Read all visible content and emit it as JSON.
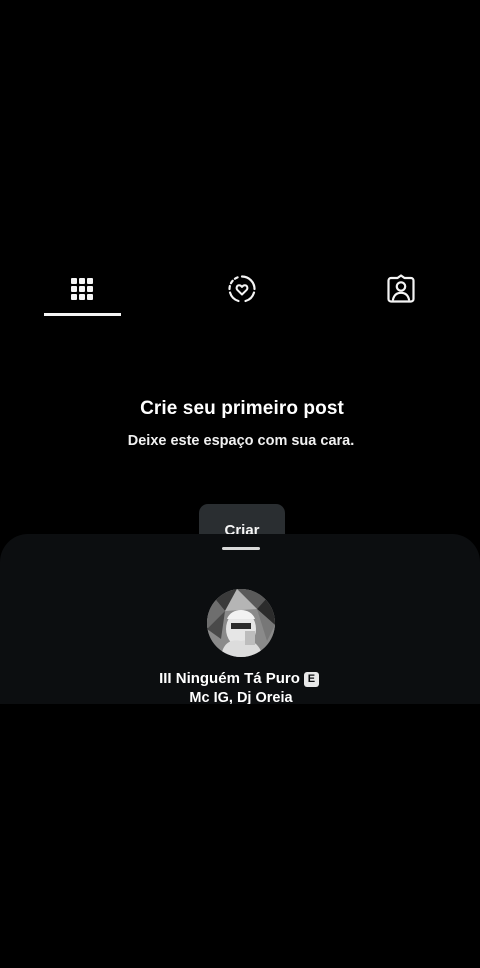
{
  "tabs": [
    {
      "name": "posts-grid",
      "icon": "grid-icon",
      "selected": true
    },
    {
      "name": "reels",
      "icon": "heart-circle-icon",
      "selected": false
    },
    {
      "name": "tagged",
      "icon": "tagged-person-icon",
      "selected": false
    }
  ],
  "empty_state": {
    "title": "Crie seu primeiro post",
    "subtitle": "Deixe este espaço com sua cara.",
    "create_label": "Criar"
  },
  "music_sheet": {
    "track_title": "III Ninguém Tá Puro",
    "explicit_badge": "E",
    "artist": "Mc IG, Dj Oreia",
    "cover_icon": "album-cover-image"
  },
  "colors": {
    "background": "#000000",
    "sheet": "#0c0e10",
    "button": "#2a2e31",
    "text": "#ffffff"
  }
}
